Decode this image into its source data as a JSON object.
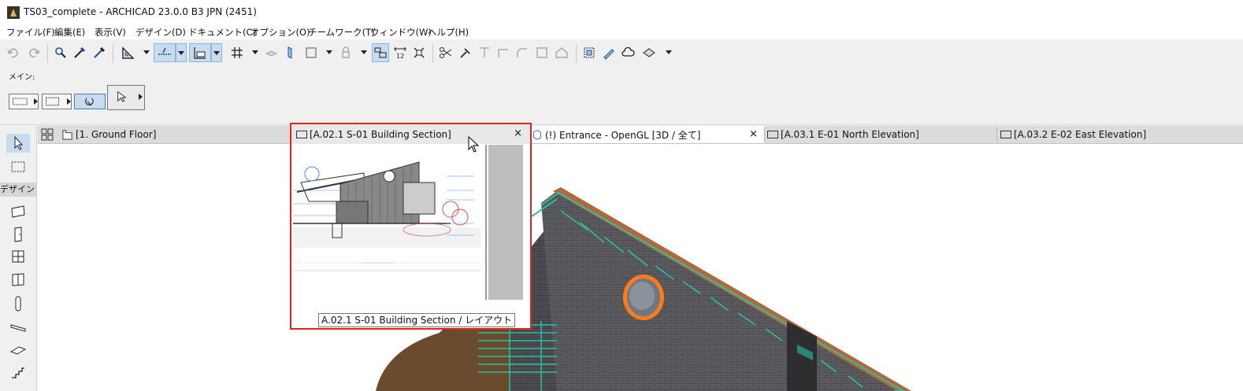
{
  "window": {
    "title": "TS03_complete - ARCHICAD 23.0.0 B3 JPN (2451)"
  },
  "menu": [
    "ファイル(F)",
    "編集(E)",
    "表示(V)",
    "デザイン(D)",
    "ドキュメント(C)",
    "オプション(O)",
    "チームワーク(T)",
    "ウィンドウ(W)",
    "ヘルプ(H)"
  ],
  "infobox": {
    "label": "メイン:"
  },
  "toolbox": {
    "section": "デザイン"
  },
  "tabs": [
    {
      "label": "[1. Ground Floor]"
    },
    {
      "label": "[A.02.1 S-01 Building Section]"
    },
    {
      "label": "(!) Entrance - OpenGL [3D / 全て]"
    },
    {
      "label": "[A.03.1 E-01 North Elevation]"
    },
    {
      "label": "[A.03.2 E-02 East Elevation]"
    }
  ],
  "preview": {
    "close": "×",
    "tooltip": "A.02.1 S-01 Building Section / レイアウト"
  },
  "tab_close": "×",
  "colors": {
    "accent": "#c7dcf1",
    "highlight_border": "#e2231a",
    "trim": "#2bbfa5",
    "window_frame": "#ff7a1a"
  }
}
